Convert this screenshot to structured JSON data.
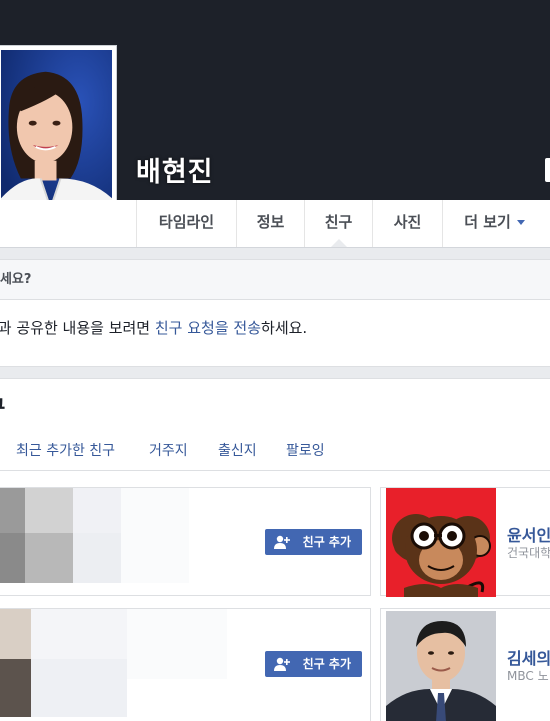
{
  "profile": {
    "name": "배현진"
  },
  "nav": {
    "tabs": [
      {
        "label": "타임라인"
      },
      {
        "label": "정보"
      },
      {
        "label": "친구"
      },
      {
        "label": "사진"
      },
      {
        "label": "더 보기"
      }
    ]
  },
  "know_card": {
    "heading": "아세요?",
    "text_before": "들과 공유한 내용을 보려면 ",
    "link": "친구 요청을 전송",
    "text_after": "하세요."
  },
  "friends": {
    "title": "구",
    "subtabs": [
      "최근 추가한 친구",
      "거주지",
      "출신지",
      "팔로잉"
    ],
    "add_button_label": "친구 추가",
    "list": [
      {
        "name": "윤서인",
        "sub": "건국대학"
      },
      {
        "name": "김세의",
        "sub": "MBC 노"
      }
    ]
  },
  "colors": {
    "cover": "#1d2129",
    "page_bg": "#e9ebee",
    "accent": "#4267b2",
    "link": "#365899"
  }
}
